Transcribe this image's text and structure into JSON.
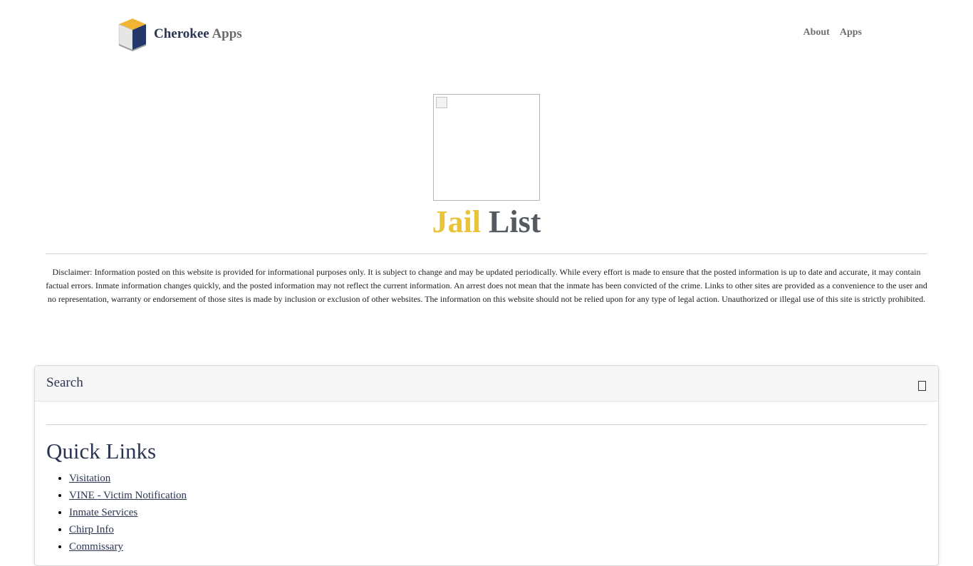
{
  "header": {
    "brand_primary": "Cherokee",
    "brand_secondary": "Apps",
    "nav": [
      {
        "label": "About"
      },
      {
        "label": "Apps"
      }
    ]
  },
  "hero": {
    "title_part1": "Jail",
    "title_part2": "List"
  },
  "disclaimer": "Disclaimer: Information posted on this website is provided for informational purposes only. It is subject to change and may be updated periodically. While every effort is made to ensure that the posted information is up to date and accurate, it may contain factual errors. Inmate information changes quickly, and the posted information may not reflect the current information. An arrest does not mean that the inmate has been convicted of the crime. Links to other sites are provided as a convenience to the user and no representation, warranty or endorsement of those sites is made by inclusion or exclusion of other websites. The information on this website should not be relied upon for any type of legal action. Unauthorized or illegal use of this site is strictly prohibited.",
  "search_card": {
    "title": "Search",
    "toggle_icon": "expand-icon"
  },
  "quick_links": {
    "title": "Quick Links",
    "items": [
      {
        "label": "Visitation"
      },
      {
        "label": "VINE - Victim Notification"
      },
      {
        "label": "Inmate Services"
      },
      {
        "label": "Chirp Info"
      },
      {
        "label": "Commissary"
      }
    ]
  },
  "colors": {
    "navy": "#2b3553",
    "yellow": "#e9c43a",
    "gray": "#555a61"
  }
}
